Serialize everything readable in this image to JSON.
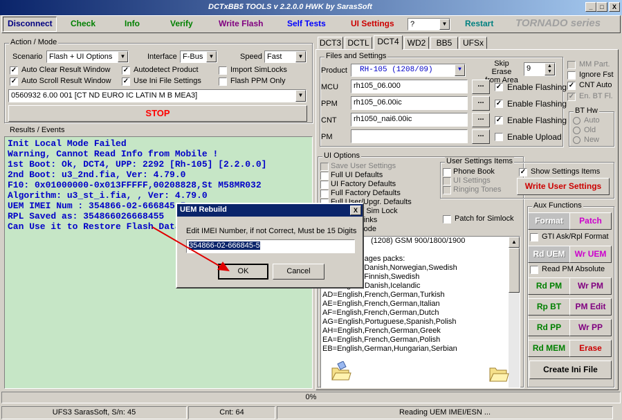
{
  "window": {
    "title": "DCTxBB5 TOOLS v 2.2.0.0 HWK by SarasSoft",
    "min": "_",
    "max": "□",
    "close": "X"
  },
  "toolbar": {
    "disconnect": "Disconnect",
    "check": "Check",
    "info": "Info",
    "verify": "Verify",
    "write_flash": "Write Flash",
    "self_tests": "Self Tests",
    "ui_settings": "UI Settings",
    "help_select": "?",
    "restart": "Restart",
    "brand": "TORNADO series"
  },
  "colors": {
    "disconnect": "#000080",
    "check": "#008000",
    "info": "#008000",
    "verify": "#008000",
    "write_flash": "#800080",
    "self_tests": "#0000ff",
    "ui_settings": "#cc0000",
    "restart": "#008080"
  },
  "action": {
    "legend": "Action / Mode",
    "scenario_label": "Scenario",
    "scenario": "Flash + UI Options",
    "interface_label": "Interface",
    "interface": "F-Bus",
    "speed_label": "Speed",
    "speed": "Fast",
    "options": [
      "Auto Clear Result Window",
      "Autodetect Product",
      "Import SimLocks",
      "Auto Scroll Result Window",
      "Use Ini File Settings",
      "Flash PPM Only"
    ],
    "product_code": "0560932 6.00 001  [CT ND EURO IC LATIN M B MEA3]",
    "stop": "STOP"
  },
  "results": {
    "legend": "Results / Events",
    "lines": [
      "Init Local Mode Failed",
      "Warning, Cannot Read Info from Mobile !",
      "1st Boot: Ok, DCT4, UPP: 2292 [Rh-105] [2.2.0.0]",
      "2nd Boot: u3_2nd.fia, Ver: 4.79.0",
      "F10: 0x01000000-0x013FFFFF,00208828,St M58MR032",
      "Algorithm: u3_st_i.fia, , Ver: 4.79.0",
      "UEM IMEI Num : 354866-02-666845-5",
      "RPL Saved as: 354866026668455",
      "Can Use it to Restore Flash Data"
    ]
  },
  "tabs": [
    "DCT3",
    "DCTL",
    "DCT4",
    "WD2",
    "BB5",
    "UFSx"
  ],
  "files": {
    "legend": "Files and Settings",
    "product_label": "Product",
    "product": "RH-105  (1208/09)",
    "skip_label": "Skip Erase from Area",
    "skip_value": "9",
    "mcu_label": "MCU",
    "mcu": "rh105_06.000",
    "ppm_label": "PPM",
    "ppm": "rh105_06.00ic",
    "cnt_label": "CNT",
    "cnt": "rh1050_nai6.00ic",
    "pm_label": "PM",
    "pm": "",
    "browse": "...",
    "enable_flashing": "Enable Flashing",
    "enable_upload": "Enable Upload",
    "mm_part": "MM Part.",
    "ignore_fst": "Ignore Fst",
    "cnt_auto": "CNT Auto",
    "en_bt_fl": "En. BT Fl.",
    "bt_hw": "BT Hw",
    "bt_auto": "Auto",
    "bt_old": "Old",
    "bt_new": "New"
  },
  "ui_options": {
    "legend": "UI Options",
    "items": [
      "Save User Settings",
      "Full UI Defaults",
      "UI Factory Defaults",
      "Full Factory Defaults",
      "Full User/Upgr. Defaults",
      "SimLock / Sim Lock",
      "Restore Links",
      "Normal Mode"
    ],
    "patch_simlock": "Patch for Simlock",
    "product_line": "(1208) GSM 900/1800/1900",
    "lang_header": "Languages packs:",
    "langs": [
      "AA=English,Danish,Norwegian,Swedish",
      "AB=English,Finnish,Swedish",
      "AC=English,Danish,Icelandic",
      "AD=English,French,German,Turkish",
      "AE=English,French,German,Italian",
      "AF=English,French,German,Dutch",
      "AG=English,Portuguese,Spanish,Polish",
      "AH=English,French,German,Greek",
      "EA=English,French,German,Polish",
      "EB=English,German,Hungarian,Serbian"
    ]
  },
  "user_settings": {
    "legend": "User Settings Items",
    "phone_book": "Phone Book",
    "ui_settings": "UI Settings",
    "ringing": "Ringing Tones",
    "show": "Show Settings Items",
    "write": "Write User Settings"
  },
  "aux": {
    "legend": "Aux Functions",
    "format": "Format",
    "patch": "Patch",
    "gti": "GTI Ask/Rpl Format",
    "rd_uem": "Rd UEM",
    "wr_uem": "Wr UEM",
    "read_pm_abs": "Read PM Absolute",
    "rd_pm": "Rd PM",
    "wr_pm": "Wr PM",
    "rp_bt": "Rp BT",
    "pm_edit": "PM Edit",
    "rd_pp": "Rd PP",
    "wr_pp": "Wr PP",
    "rd_mem": "Rd MEM",
    "erase": "Erase",
    "create_ini": "Create Ini File"
  },
  "progress": {
    "text": "0%",
    "value": 0
  },
  "status": {
    "left": "UFS3 SarasSoft, S/n: 45",
    "mid": "Cnt: 64",
    "right": "Reading UEM IMEI/ESN ..."
  },
  "dialog": {
    "title": "UEM Rebuild",
    "prompt": "Edit IMEI Number, if not Correct, Must be 15 Digits",
    "value": "354866-02-666845-5",
    "ok": "OK",
    "cancel": "Cancel",
    "close": "X"
  }
}
